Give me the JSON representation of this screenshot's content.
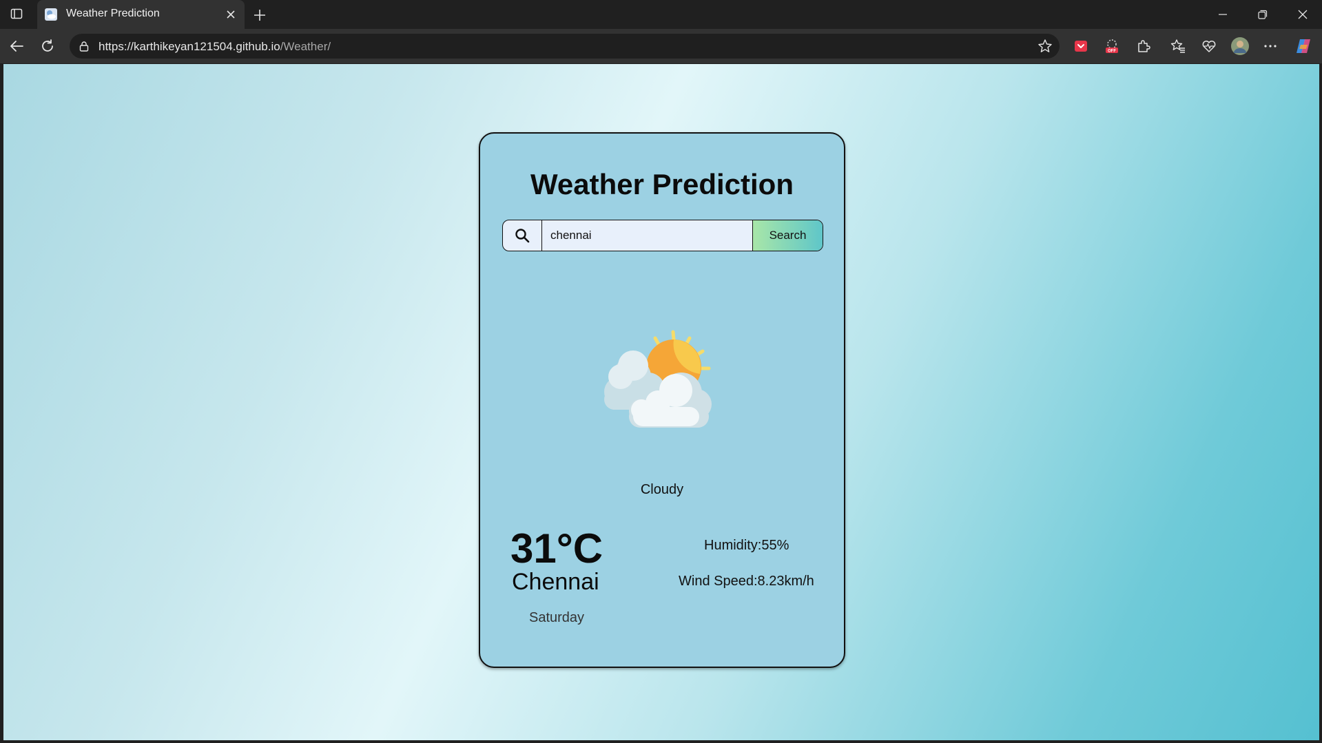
{
  "browser": {
    "tab_title": "Weather Prediction",
    "url_host": "https://karthikeyan121504.github.io",
    "url_path": "/Weather/"
  },
  "app": {
    "title": "Weather Prediction",
    "search": {
      "value": "chennai",
      "button_label": "Search"
    },
    "weather": {
      "icon": "sun-behind-clouds-icon",
      "condition": "Cloudy",
      "temperature": "31°C",
      "city": "Chennai",
      "day": "Saturday",
      "humidity": "Humidity:55%",
      "wind_speed": "Wind Speed:8.23km/h"
    }
  },
  "colors": {
    "card_bg": "#9cd1e3",
    "search_button_gradient_start": "#a8e6a8",
    "search_button_gradient_end": "#5fc6c9"
  }
}
